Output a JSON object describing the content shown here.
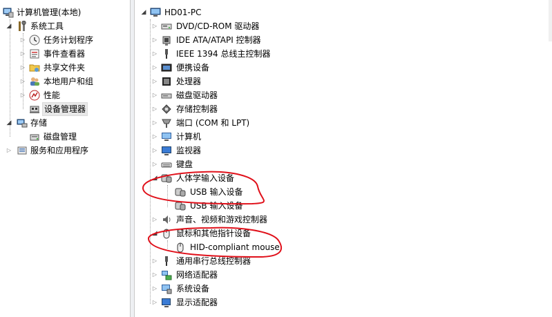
{
  "left_tree": {
    "root": "计算机管理(本地)",
    "system_tools": "系统工具",
    "task_scheduler": "任务计划程序",
    "event_viewer": "事件查看器",
    "shared_folders": "共享文件夹",
    "local_users": "本地用户和组",
    "performance": "性能",
    "device_manager": "设备管理器",
    "storage": "存储",
    "disk_management": "磁盘管理",
    "services_apps": "服务和应用程序"
  },
  "right_tree": {
    "computer_name": "HD01-PC",
    "categories": [
      "DVD/CD-ROM 驱动器",
      "IDE ATA/ATAPI 控制器",
      "IEEE 1394 总线主控制器",
      "便携设备",
      "处理器",
      "磁盘驱动器",
      "存储控制器",
      "端口 (COM 和 LPT)",
      "计算机",
      "监视器",
      "键盘",
      "人体学输入设备",
      "声音、视频和游戏控制器",
      "鼠标和其他指针设备",
      "通用串行总线控制器",
      "网络适配器",
      "系统设备",
      "显示适配器"
    ],
    "hid_children": [
      "USB 输入设备",
      "USB 输入设备"
    ],
    "mouse_children": [
      "HID-compliant mouse"
    ]
  },
  "colors": {
    "annotation": "#e0101a",
    "tree_line": "#a0a0a0",
    "selection_bg": "#e8e8e8"
  }
}
